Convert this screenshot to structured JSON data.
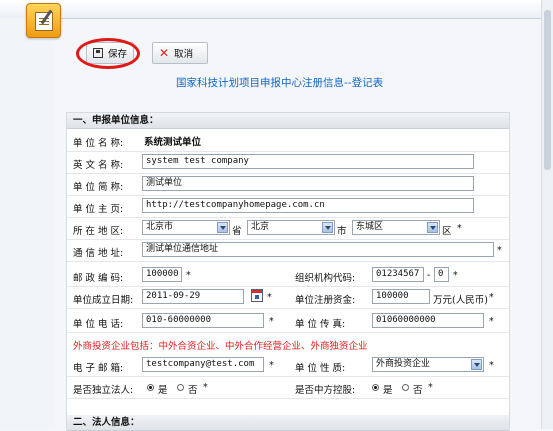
{
  "toolbar": {
    "save_label": "保存",
    "cancel_label": "取消"
  },
  "page_title": "国家科技计划项目申报中心注册信息--登记表",
  "section1": "一、申报单位信息：",
  "section2": "二、法人信息：",
  "fields": {
    "unit_name": {
      "label": "单 位 名 称:",
      "value": "系统测试单位"
    },
    "english_name": {
      "label": "英 文 名 称:",
      "value": "system test company"
    },
    "short_name": {
      "label": "单 位 简 称:",
      "value": "测试单位"
    },
    "homepage": {
      "label": "单 位 主 页:",
      "value": "http://testcompanyhomepage.com.cn"
    },
    "region": {
      "label": "所 在 地 区:",
      "province": "北京市",
      "province_suffix": "省",
      "city": "北京",
      "city_suffix": "市",
      "district": "东城区",
      "district_suffix": "区"
    },
    "address": {
      "label": "通 信 地 址:",
      "value": "测试单位通信地址"
    },
    "postcode": {
      "label": "邮 政 编 码:",
      "value": "100000"
    },
    "org_code": {
      "label": "组织机构代码:",
      "value": "01234567",
      "dash": "-",
      "check": "0"
    },
    "founded": {
      "label": "单位成立日期:",
      "value": "2011-09-29"
    },
    "capital": {
      "label": "单位注册资金:",
      "value": "100000",
      "unit": "万元(人民币)"
    },
    "phone": {
      "label": "单 位 电 话:",
      "value": "010-60000000"
    },
    "fax": {
      "label": "单 位 传 真:",
      "value": "01060000000"
    },
    "foreign_note": "外商投资企业包括：中外合资企业、中外合作经营企业、外商独资企业",
    "email": {
      "label": "电 子 邮 箱:",
      "value": "testcompany@test.com"
    },
    "nature": {
      "label": "单 位 性 质:",
      "value": "外商投资企业"
    },
    "independent": {
      "label": "是否独立法人:",
      "yes": "是",
      "no": "否"
    },
    "china_holding": {
      "label": "是否中方控股:",
      "yes": "是",
      "no": "否"
    }
  },
  "required_mark": "*"
}
